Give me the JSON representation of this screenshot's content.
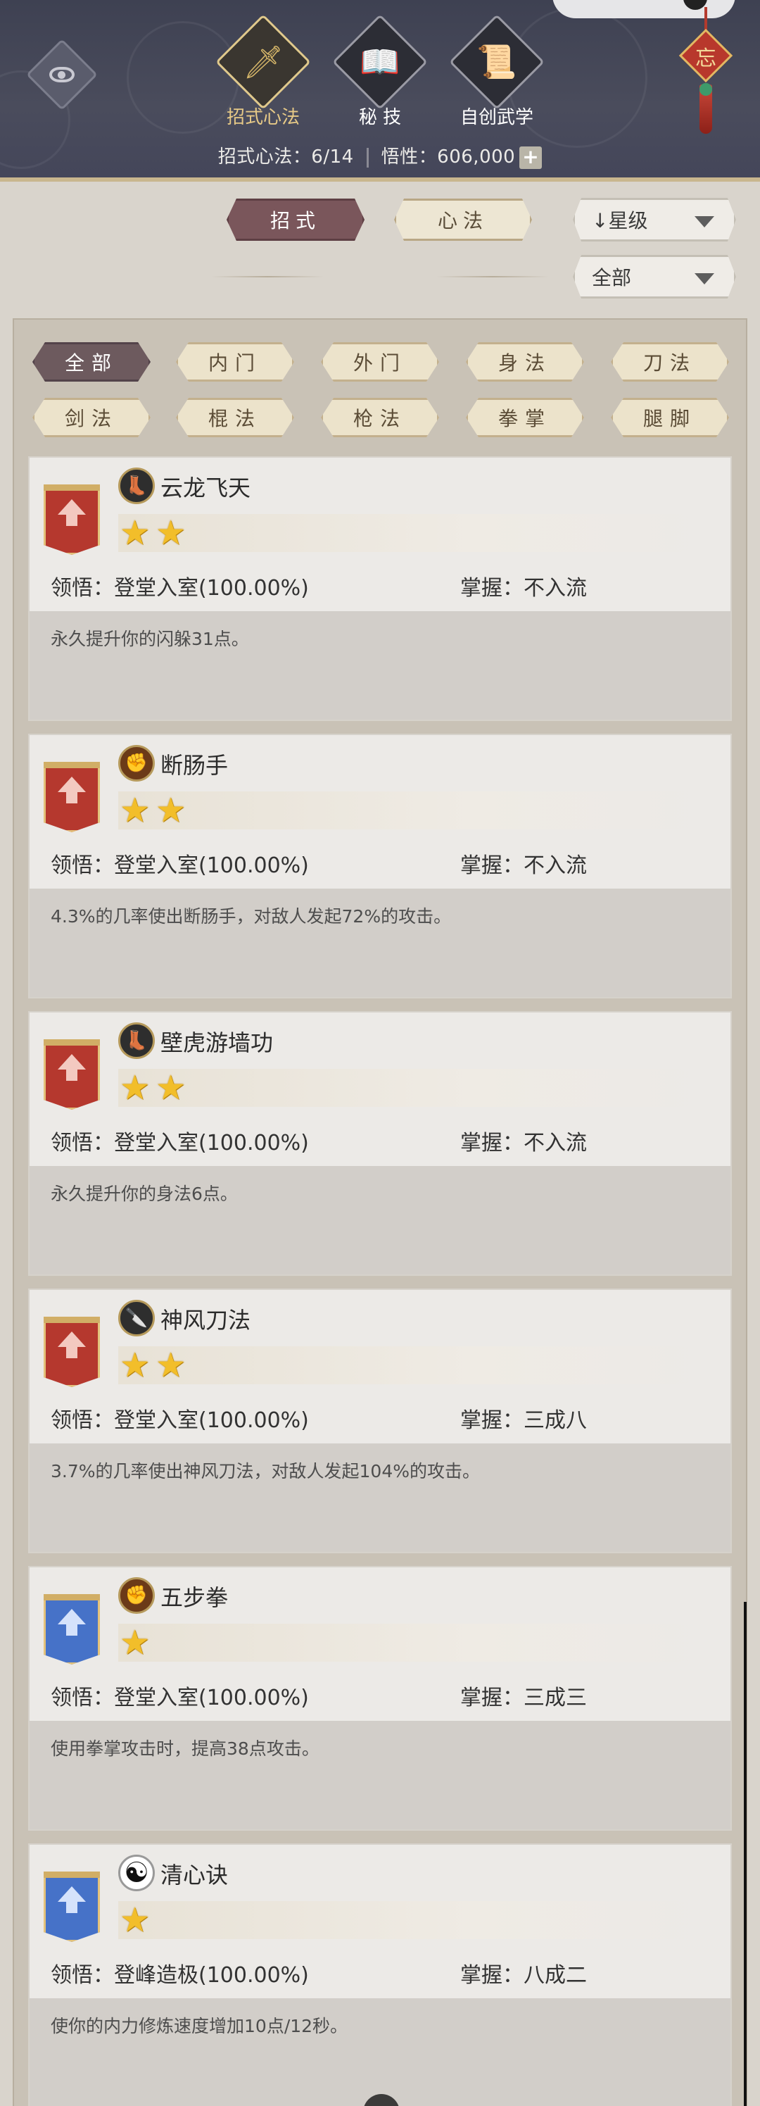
{
  "header": {
    "tabs": [
      {
        "label": "招式心法",
        "icon": "sword-icon",
        "glyph": "🗡",
        "active": true
      },
      {
        "label": "秘 技",
        "icon": "book-icon",
        "glyph": "📖",
        "active": false
      },
      {
        "label": "自创武学",
        "icon": "scroll-brush-icon",
        "glyph": "📜",
        "active": false
      }
    ],
    "stat_progress_label": "招式心法：6/14",
    "stat_wuxing_label": "悟性：606,000",
    "plus_label": "+",
    "charm_text": "忘"
  },
  "subnav": {
    "tab_zhaoshi": "招式",
    "tab_xinfa": "心法",
    "sort_label": "↓星级",
    "filter_label": "全部"
  },
  "filters": [
    "全部",
    "内门",
    "外门",
    "身法",
    "刀法",
    "剑法",
    "棍法",
    "枪法",
    "拳掌",
    "腿脚"
  ],
  "cards": [
    {
      "name": "云龙飞天",
      "icon": "boot-icon",
      "glyph": "👢",
      "iconClass": "boot",
      "banner": "red",
      "stars": 2,
      "comprehension": "领悟：登堂入室(100.00%)",
      "mastery": "掌握：不入流",
      "desc": "永久提升你的闪躲31点。"
    },
    {
      "name": "断肠手",
      "icon": "fist-icon",
      "glyph": "✊",
      "iconClass": "fist",
      "banner": "red",
      "stars": 2,
      "comprehension": "领悟：登堂入室(100.00%)",
      "mastery": "掌握：不入流",
      "desc": "4.3%的几率使出断肠手，对敌人发起72%的攻击。"
    },
    {
      "name": "壁虎游墙功",
      "icon": "boot-icon",
      "glyph": "👢",
      "iconClass": "boot",
      "banner": "red",
      "stars": 2,
      "comprehension": "领悟：登堂入室(100.00%)",
      "mastery": "掌握：不入流",
      "desc": "永久提升你的身法6点。"
    },
    {
      "name": "神风刀法",
      "icon": "blade-icon",
      "glyph": "🔪",
      "iconClass": "blade",
      "banner": "red",
      "stars": 2,
      "comprehension": "领悟：登堂入室(100.00%)",
      "mastery": "掌握：三成八",
      "desc": "3.7%的几率使出神风刀法，对敌人发起104%的攻击。"
    },
    {
      "name": "五步拳",
      "icon": "fist-icon",
      "glyph": "✊",
      "iconClass": "fist",
      "banner": "blue",
      "stars": 1,
      "comprehension": "领悟：登堂入室(100.00%)",
      "mastery": "掌握：三成三",
      "desc": "使用拳掌攻击时，提高38点攻击。"
    },
    {
      "name": "清心诀",
      "icon": "taiji-icon",
      "glyph": "☯",
      "iconClass": "taiji",
      "banner": "blue",
      "stars": 1,
      "comprehension": "领悟：登峰造极(100.00%)",
      "mastery": "掌握：八成二",
      "desc": "使你的内力修炼速度增加10点/12秒。"
    }
  ]
}
